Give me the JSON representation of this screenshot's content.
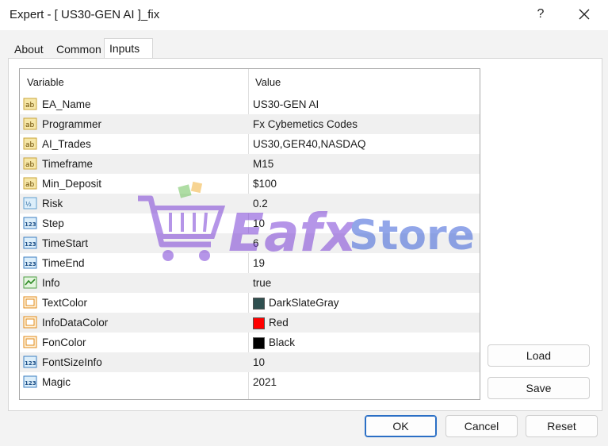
{
  "window": {
    "title": "Expert - [ US30-GEN AI ]_fix",
    "help": "?",
    "close_icon": "close-icon"
  },
  "tabs": [
    {
      "label": "About",
      "active": false
    },
    {
      "label": "Common",
      "active": false
    },
    {
      "label": "Inputs",
      "active": true
    }
  ],
  "grid": {
    "headers": {
      "variable": "Variable",
      "value": "Value"
    },
    "rows": [
      {
        "icon": "string-icon",
        "name": "EA_Name",
        "value": "US30-GEN AI"
      },
      {
        "icon": "string-icon",
        "name": "Programmer",
        "value": "Fx Cybemetics Codes"
      },
      {
        "icon": "string-icon",
        "name": "AI_Trades",
        "value": "US30,GER40,NASDAQ"
      },
      {
        "icon": "string-icon",
        "name": "Timeframe",
        "value": "M15"
      },
      {
        "icon": "string-icon",
        "name": "Min_Deposit",
        "value": "$100"
      },
      {
        "icon": "double-icon",
        "name": "Risk",
        "value": "0.2"
      },
      {
        "icon": "integer-icon",
        "name": "Step",
        "value": "10"
      },
      {
        "icon": "integer-icon",
        "name": "TimeStart",
        "value": "6"
      },
      {
        "icon": "integer-icon",
        "name": "TimeEnd",
        "value": "19"
      },
      {
        "icon": "bool-icon",
        "name": "Info",
        "value": "true"
      },
      {
        "icon": "color-icon",
        "name": "TextColor",
        "value": "DarkSlateGray",
        "swatch": "#2f4f4f"
      },
      {
        "icon": "color-icon",
        "name": "InfoDataColor",
        "value": "Red",
        "swatch": "#ff0000"
      },
      {
        "icon": "color-icon",
        "name": "FonColor",
        "value": "Black",
        "swatch": "#000000"
      },
      {
        "icon": "integer-icon",
        "name": "FontSizeInfo",
        "value": "10"
      },
      {
        "icon": "integer-icon",
        "name": "Magic",
        "value": "2021"
      }
    ]
  },
  "watermark": {
    "text_primary": "Eafx",
    "text_secondary": "Store",
    "icon": "shopping-cart-icon"
  },
  "side_buttons": {
    "load": "Load",
    "save": "Save"
  },
  "footer_buttons": {
    "ok": "OK",
    "cancel": "Cancel",
    "reset": "Reset"
  },
  "colors": {
    "accent": "#2b6fc5",
    "watermark_purple": "#7a3fd6",
    "watermark_blue": "#3a5fd8",
    "watermark_green": "#6fc25a"
  }
}
